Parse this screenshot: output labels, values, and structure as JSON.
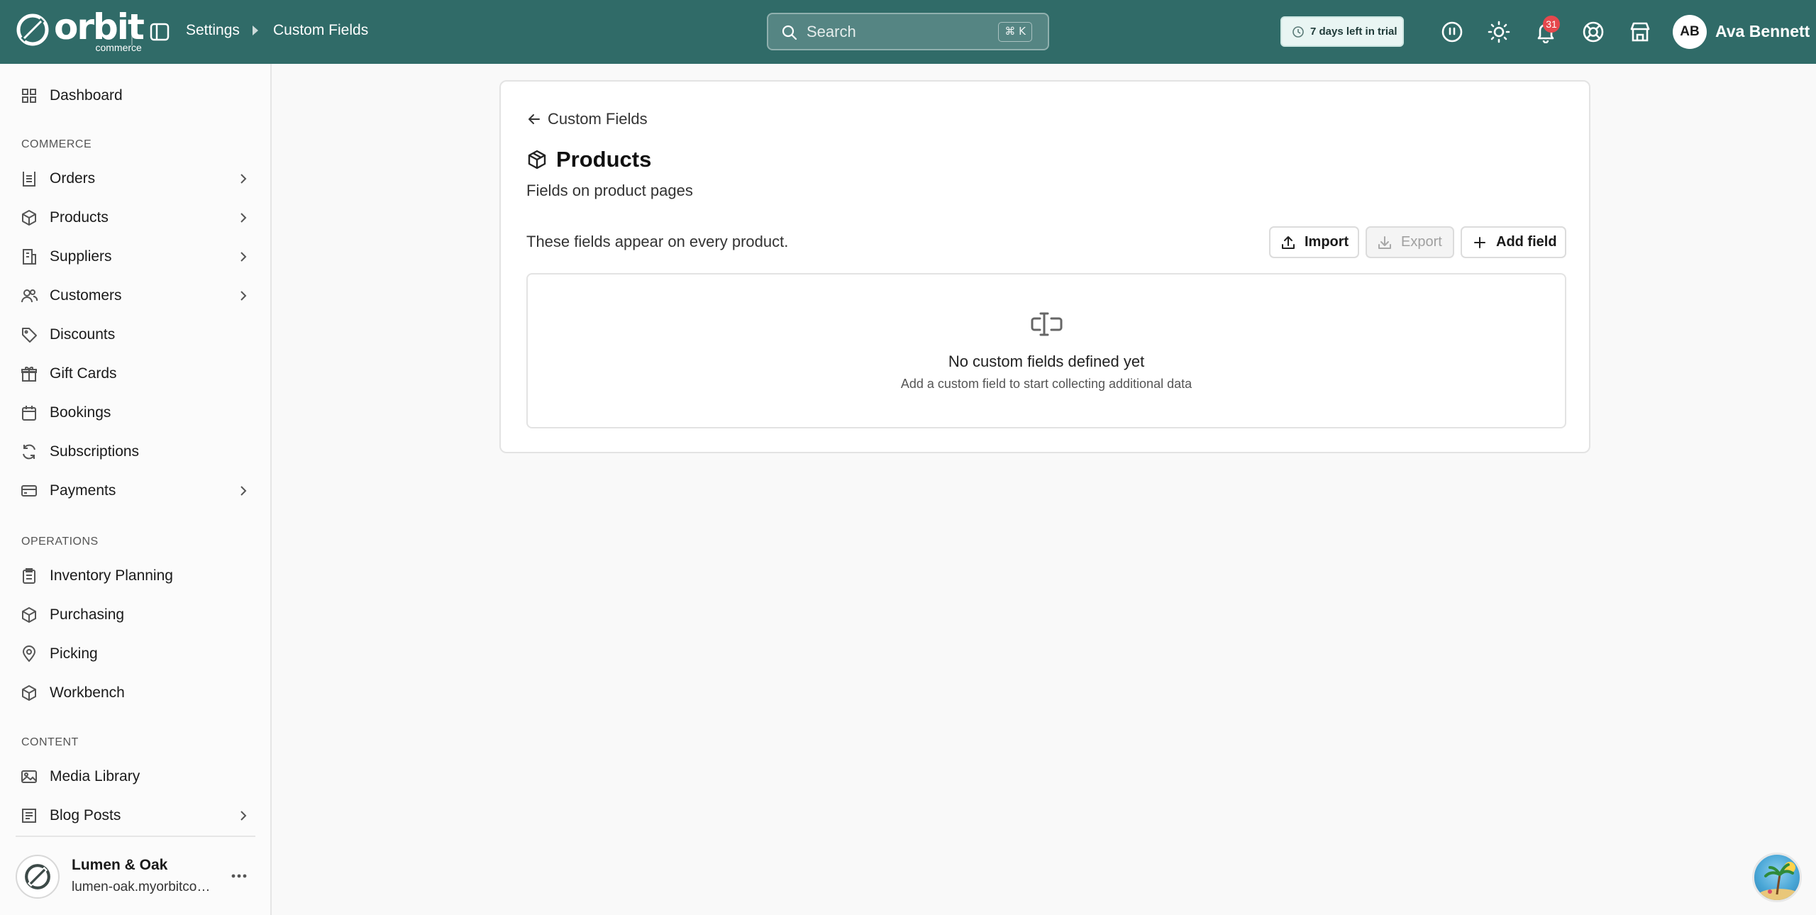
{
  "topbar": {
    "logo_word": "orbit",
    "logo_sub": "commerce",
    "breadcrumb": [
      "Settings",
      "Custom Fields"
    ],
    "search_placeholder": "Search",
    "search_shortcut": "⌘ K",
    "trial_text": "7 days left in trial",
    "notification_count": "31",
    "user_initials": "AB",
    "user_name": "Ava Bennett"
  },
  "sidebar": {
    "dashboard": "Dashboard",
    "sections": {
      "commerce": "COMMERCE",
      "operations": "OPERATIONS",
      "content": "CONTENT"
    },
    "commerce_items": [
      "Orders",
      "Products",
      "Suppliers",
      "Customers",
      "Discounts",
      "Gift Cards",
      "Bookings",
      "Subscriptions",
      "Payments"
    ],
    "operations_items": [
      "Inventory Planning",
      "Purchasing",
      "Picking",
      "Workbench"
    ],
    "content_items": [
      "Media Library",
      "Blog Posts"
    ],
    "store_name": "Lumen & Oak",
    "store_url": "lumen-oak.myorbitcommerce.com"
  },
  "main": {
    "back_label": "Custom Fields",
    "title": "Products",
    "subtitle": "Fields on product pages",
    "description": "These fields appear on every product.",
    "buttons": {
      "import": "Import",
      "export": "Export",
      "add": "Add field"
    },
    "empty": {
      "title": "No custom fields defined yet",
      "subtitle": "Add a custom field to start collecting additional data"
    }
  },
  "colors": {
    "topbar": "#306b68",
    "badge": "#e5484d"
  }
}
